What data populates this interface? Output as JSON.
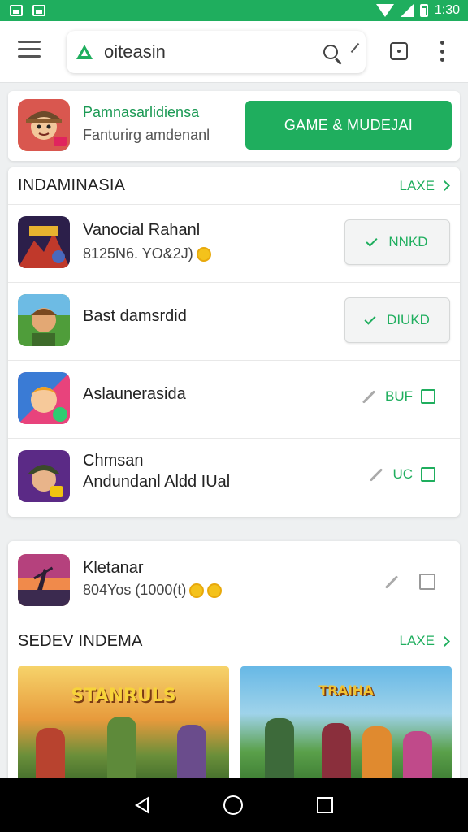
{
  "status_bar": {
    "time": "1:30"
  },
  "app_bar": {
    "search_text": "oiteasin"
  },
  "promo": {
    "title": "Pamnasarlidiensa",
    "subtitle": "Fanturirg amdenanl",
    "button_label": "GAME & MUDEJAI"
  },
  "section1": {
    "title": "INDAMINASIA",
    "see_more": "LAXE",
    "items": [
      {
        "name": "Vanocial Rahanl",
        "meta": "8125N6. YO&2J)",
        "action": "NNKD"
      },
      {
        "name": "Bast damsrdid",
        "action": "DIUKD"
      },
      {
        "name": "Aslaunerasida",
        "action": "BUF"
      },
      {
        "name_line1": "Chmsan",
        "name_line2": "Andundanl Aldd IUal",
        "action": "UC"
      }
    ]
  },
  "section2": {
    "item": {
      "name": "Kletanar",
      "meta": "804Yos (1000(t)"
    },
    "title": "SEDEV INDEMA",
    "see_more": "LAXE",
    "banners": [
      {
        "title": "STANRULS"
      },
      {
        "title": "TRAIHA"
      }
    ]
  },
  "colors": {
    "accent": "#1fae5e",
    "status_bar": "#1fae5e"
  }
}
